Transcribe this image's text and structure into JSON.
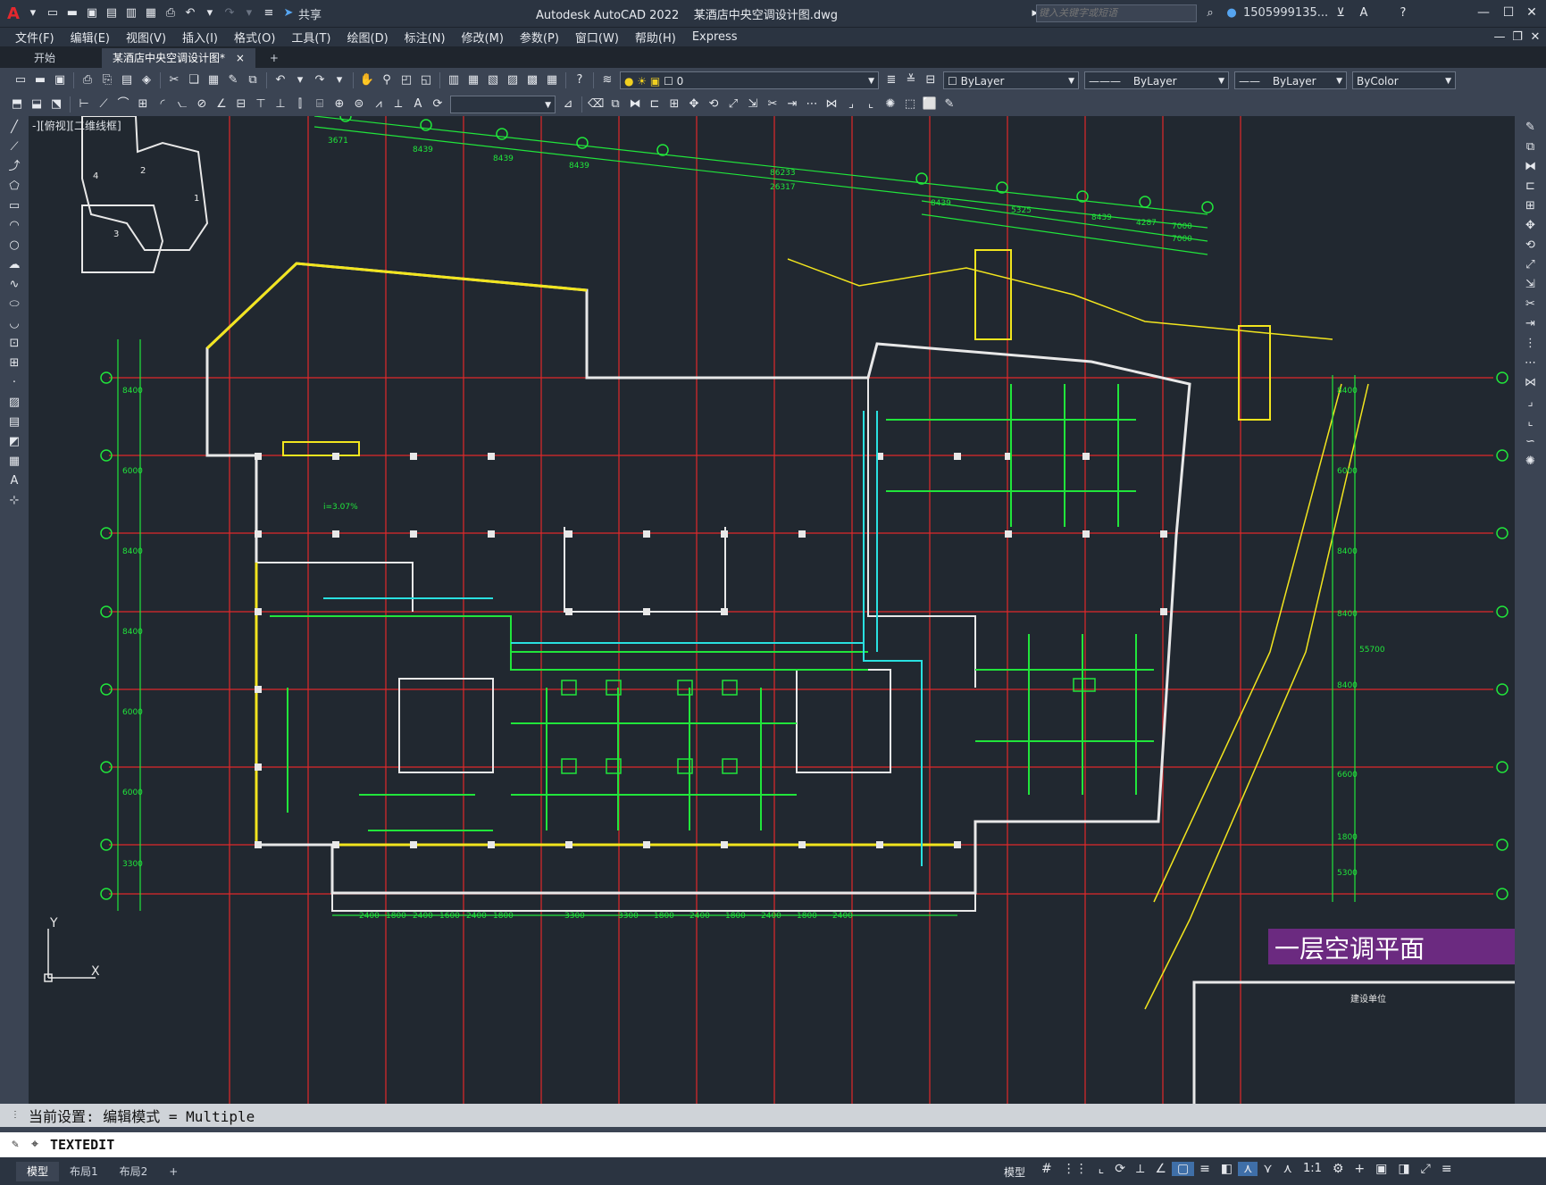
{
  "titlebar": {
    "app_letter": "A",
    "share_label": "共享",
    "title": "Autodesk AutoCAD 2022    某酒店中央空调设计图.dwg",
    "search_placeholder": "键入关键字或短语",
    "user": "1505999135..."
  },
  "menu": [
    "文件(F)",
    "编辑(E)",
    "视图(V)",
    "插入(I)",
    "格式(O)",
    "工具(T)",
    "绘图(D)",
    "标注(N)",
    "修改(M)",
    "参数(P)",
    "窗口(W)",
    "帮助(H)",
    "Express"
  ],
  "tabs": {
    "start": "开始",
    "drawing": "某酒店中央空调设计图*",
    "close": "×",
    "add": "+"
  },
  "layers": {
    "current_layer": "0",
    "color": "ByLayer",
    "linetype": "ByLayer",
    "lineweight": "ByLayer",
    "plotstyle": "ByColor"
  },
  "viewport": {
    "label": "-][俯视][二维线框]"
  },
  "drawing": {
    "title_block_text": "一层空调平面",
    "corner_label": "建设单位",
    "overall_dim": "86233",
    "overall_dim2": "26317",
    "dims_top": [
      "3671",
      "8439",
      "8439",
      "8439",
      "8439"
    ],
    "dims_right": [
      "8439",
      "5325",
      "8439",
      "4287",
      "7000",
      "7000"
    ],
    "dims_bottom": [
      "2400",
      "1800",
      "2400",
      "1600",
      "2400",
      "1800",
      "3300",
      "3300",
      "1800",
      "2400",
      "1800",
      "2400",
      "1800",
      "2400"
    ],
    "dims_left": [
      "8400",
      "6000",
      "8400",
      "8400",
      "6000",
      "6000",
      "3300"
    ],
    "dims_farright": [
      "8400",
      "6000",
      "8400",
      "8400",
      "55700",
      "8400",
      "6600",
      "1800",
      "5300"
    ],
    "slope_label": "i=3.07%",
    "floor_labels": [
      "1",
      "2",
      "3",
      "4"
    ]
  },
  "command": {
    "history": "当前设置: 编辑模式 = Multiple",
    "prompt_icon": "⌖",
    "input": "TEXTEDIT"
  },
  "status": {
    "layout_tabs": [
      "模型",
      "布局1",
      "布局2"
    ],
    "model_label": "模型",
    "scale": "1:1"
  },
  "colors": {
    "canvas": "#212830",
    "grid_red": "#e0282b",
    "wall_white": "#e8e8e8",
    "duct_green": "#21e53b",
    "cyan": "#29e0e0",
    "yellow": "#f2e51e",
    "title_purple": "#6b2a80"
  }
}
